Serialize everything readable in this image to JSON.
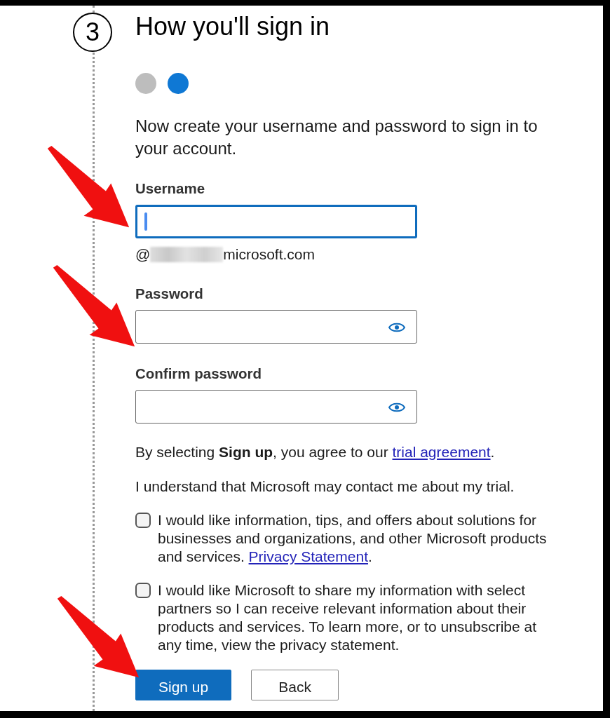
{
  "step": {
    "number": "3",
    "title": "How you'll sign in"
  },
  "progress_dots": [
    {
      "selected": false
    },
    {
      "selected": true
    }
  ],
  "intro": "Now create your username and password to sign in to your account.",
  "fields": [
    {
      "kind": "username",
      "label": "Username",
      "focused": true,
      "domain_prefix": "@",
      "domain_suffix": "microsoft.com"
    },
    {
      "kind": "password",
      "label": "Password",
      "focused": false
    },
    {
      "kind": "password",
      "label": "Confirm password",
      "focused": false
    }
  ],
  "terms": {
    "before": "By selecting **Sign up**, you agree to our ",
    "link": "trial agreement",
    "after": "."
  },
  "notice": "I understand that Microsoft may contact me about my trial.",
  "consents": [
    {
      "checked": false,
      "text": "I would like information, tips, and offers about solutions for businesses and organizations, and other Microsoft products and services. ",
      "link": "Privacy Statement",
      "after": "."
    },
    {
      "checked": false,
      "text": "I would like Microsoft to share my information with select partners so I can receive relevant information about their products and services. To learn more, or to unsubscribe at any time, view the privacy statement."
    }
  ],
  "buttons": [
    {
      "kind": "primary",
      "label": "Sign up"
    },
    {
      "kind": "secondary",
      "label": "Back"
    }
  ],
  "annotation_arrows": [
    {
      "kind": "arrow"
    },
    {
      "kind": "arrow"
    },
    {
      "kind": "arrow"
    }
  ]
}
